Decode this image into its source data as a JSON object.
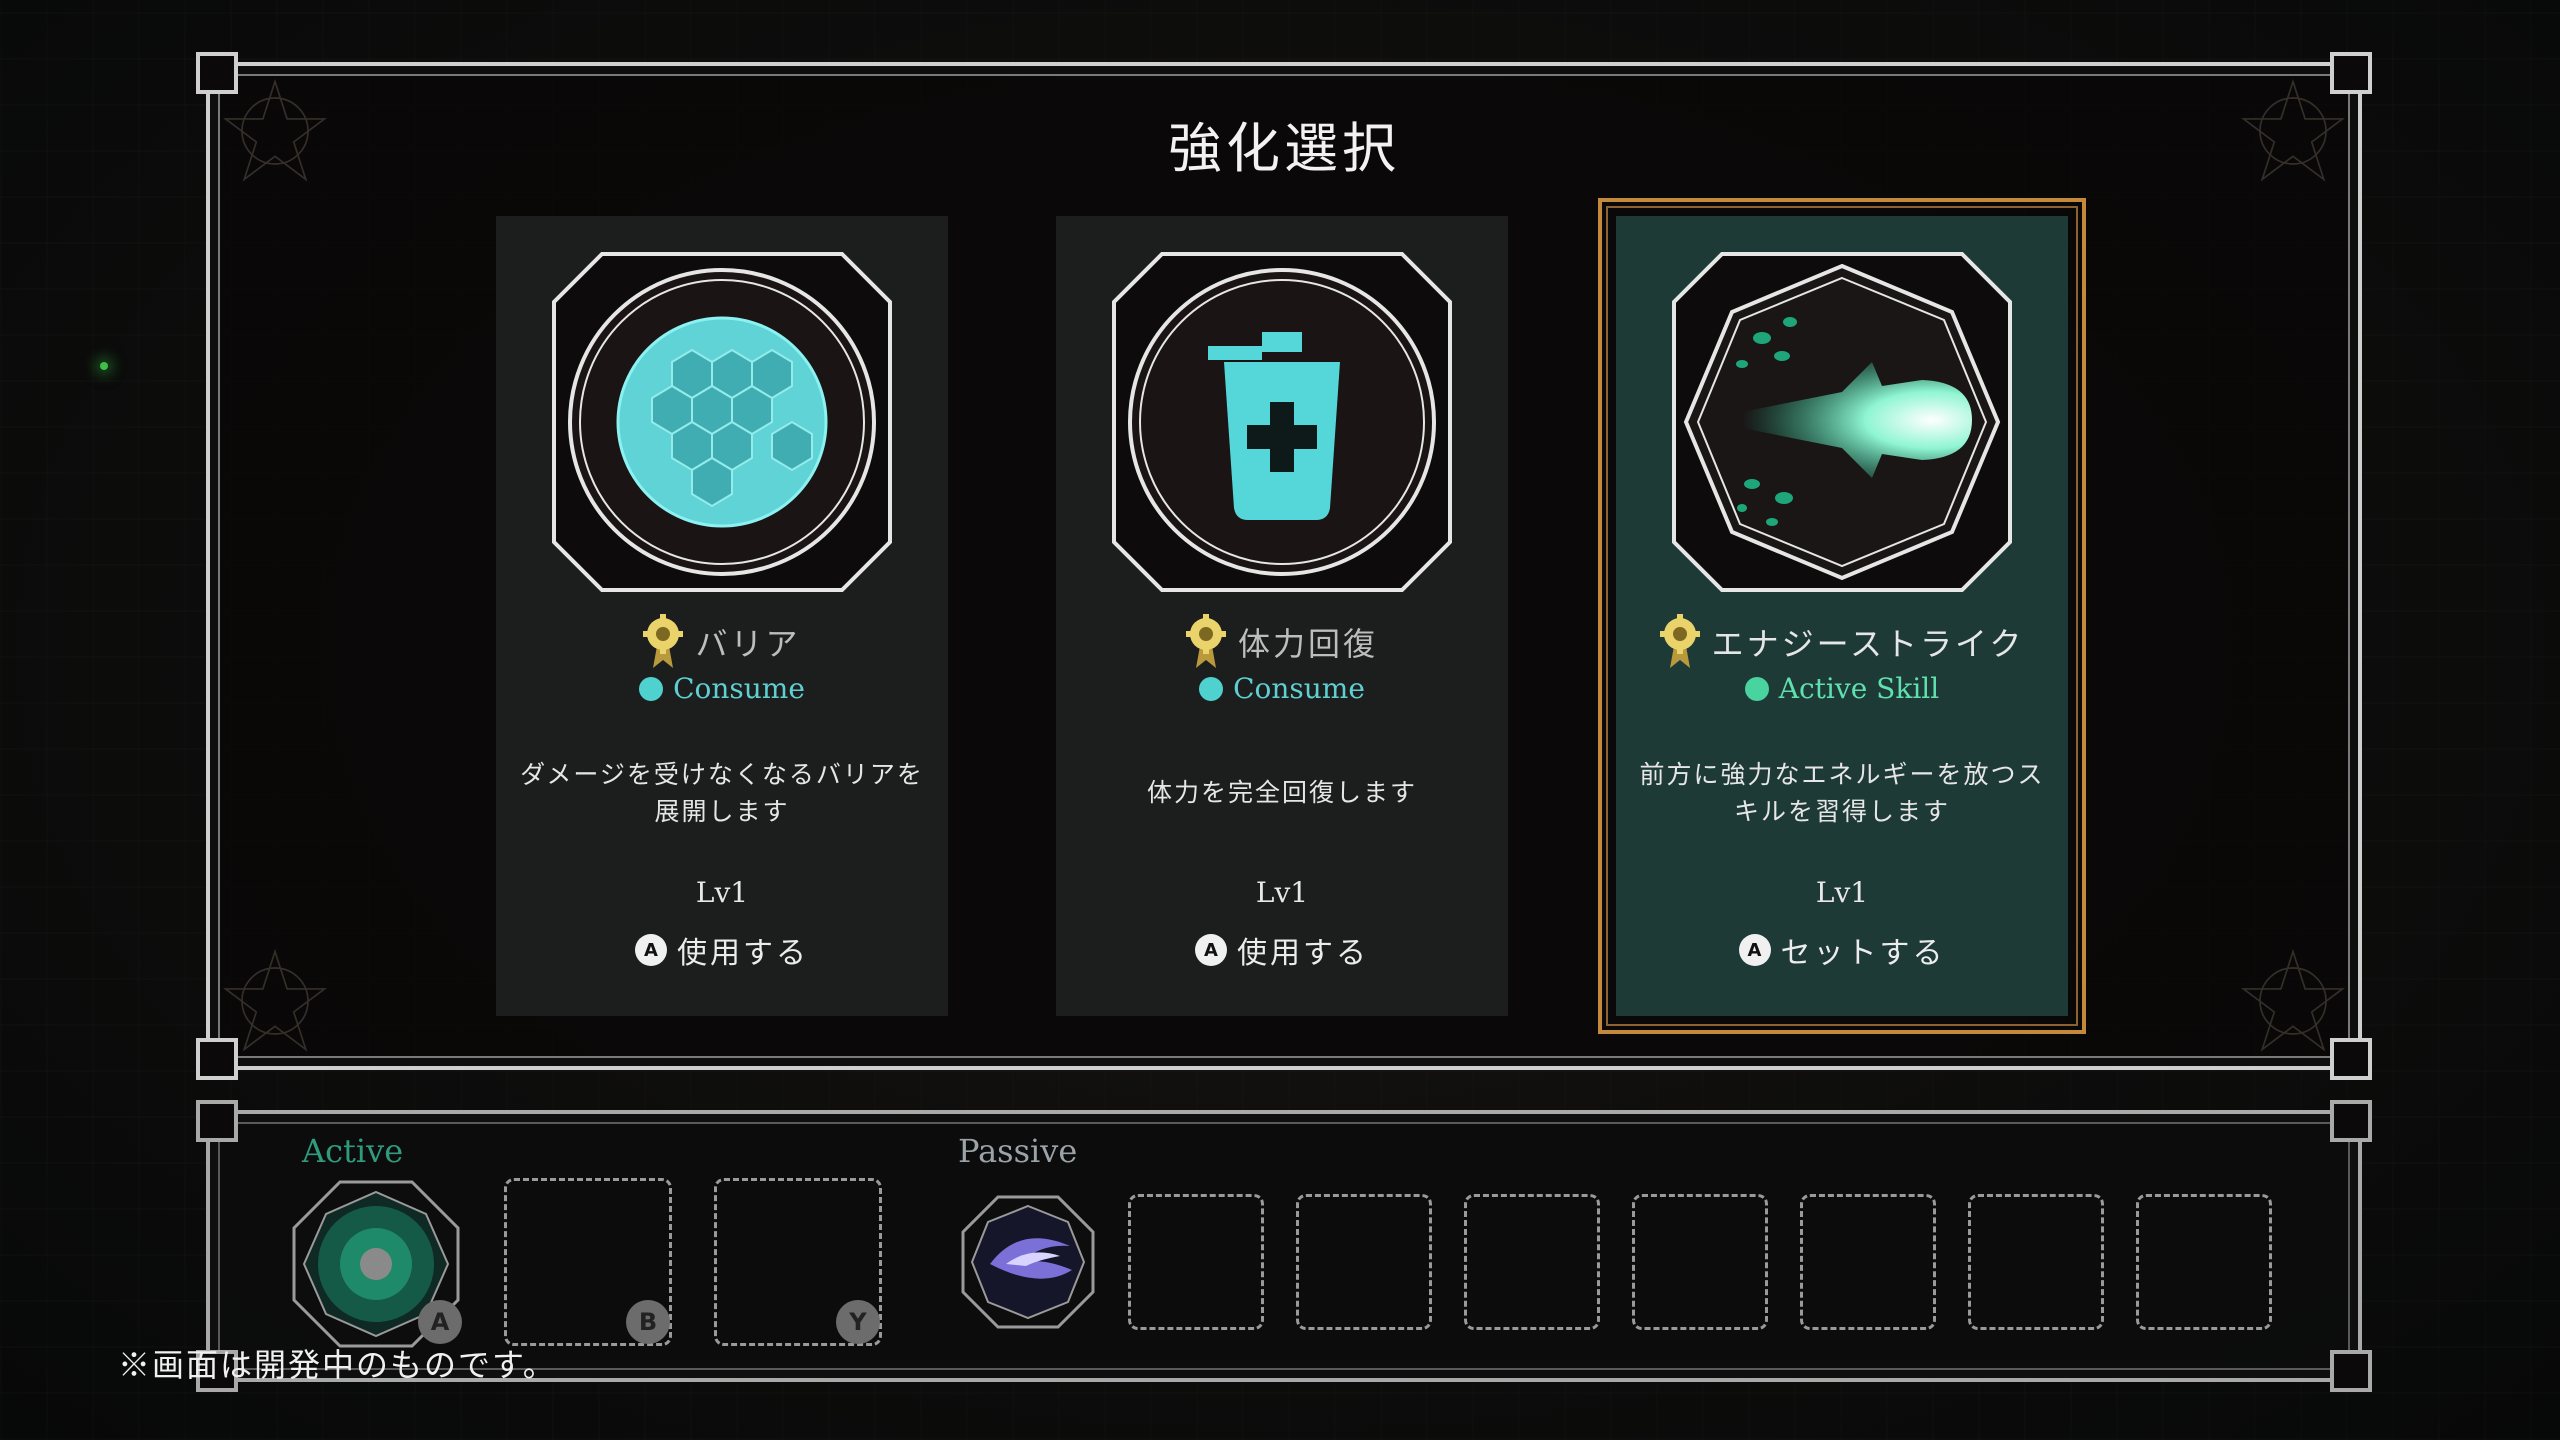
{
  "dialog": {
    "title": "強化選択"
  },
  "cards": [
    {
      "name": "バリア",
      "type": "Consume",
      "description_line1": "ダメージを受けなくなるバリアを",
      "description_line2": "展開します",
      "level": "Lv1",
      "button_glyph": "A",
      "action": "使用する",
      "icon": "barrier-icon",
      "selected": false
    },
    {
      "name": "体力回復",
      "type": "Consume",
      "description_line1": "体力を完全回復します",
      "description_line2": "",
      "level": "Lv1",
      "button_glyph": "A",
      "action": "使用する",
      "icon": "health-potion-icon",
      "selected": false
    },
    {
      "name": "エナジーストライク",
      "type": "Active Skill",
      "description_line1": "前方に強力なエネルギーを放つス",
      "description_line2": "キルを習得します",
      "level": "Lv1",
      "button_glyph": "A",
      "action": "セットする",
      "icon": "energy-strike-icon",
      "selected": true
    }
  ],
  "skill_bar": {
    "active_label": "Active",
    "passive_label": "Passive",
    "active_buttons": [
      "A",
      "B",
      "Y"
    ],
    "active_equipped_icon": "green-burst-icon",
    "passive_equipped_icon": "purple-wing-icon"
  },
  "footer_note": "※画面は開発中のものです。",
  "colors": {
    "consume_dot": "#4fd1d0",
    "active_skill_dot": "#49d39e",
    "selected_border": "#c48a3c",
    "selected_card_bg": "#1d3a37"
  }
}
